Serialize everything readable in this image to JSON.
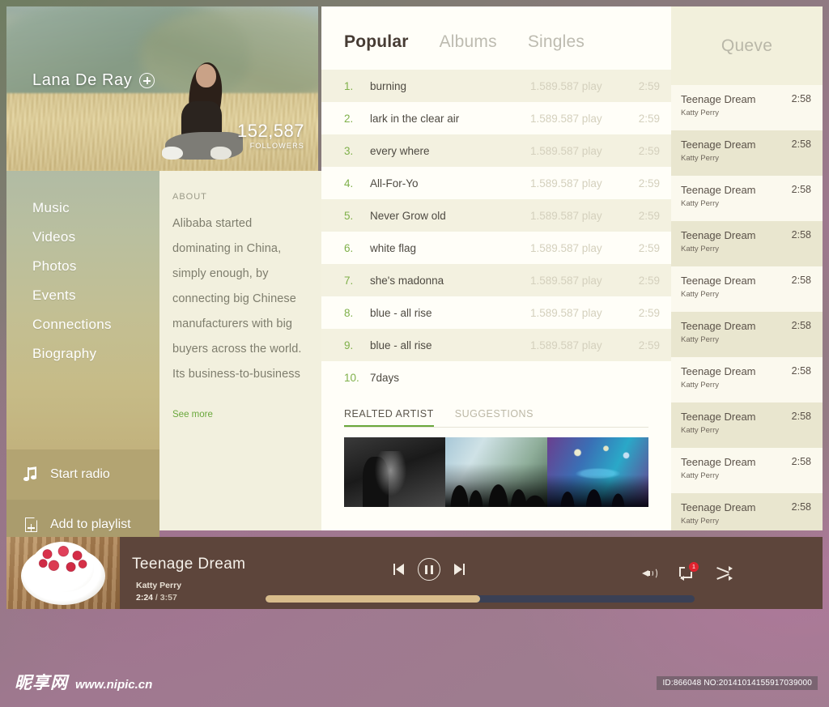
{
  "hero": {
    "artist_name": "Lana De Ray",
    "follow_icon": "plus-circle-icon",
    "followers_count": "152,587",
    "followers_label": "FOLLOWERS"
  },
  "sidebar": {
    "items": [
      {
        "label": "Music"
      },
      {
        "label": "Videos"
      },
      {
        "label": "Photos"
      },
      {
        "label": "Events"
      },
      {
        "label": "Connections"
      },
      {
        "label": "Biography"
      }
    ],
    "actions": [
      {
        "label": "Start radio",
        "icon": "music-note-icon"
      },
      {
        "label": "Add to playlist",
        "icon": "page-plus-icon"
      }
    ]
  },
  "about": {
    "title": "ABOUT",
    "text": "Alibaba started dominating in China, simply enough, by connecting big Chinese manufacturers with big buyers across the world. Its business-to-business",
    "see_more": "See more",
    "see_more_color": "#6aa83c"
  },
  "main": {
    "tabs": [
      {
        "label": "Popular",
        "active": true
      },
      {
        "label": "Albums",
        "active": false
      },
      {
        "label": "Singles",
        "active": false
      }
    ],
    "tracks": [
      {
        "num": "1.",
        "title": "burning",
        "plays": "1.589.587 play",
        "dur": "2:59"
      },
      {
        "num": "2.",
        "title": "lark in the clear air",
        "plays": "1.589.587 play",
        "dur": "2:59"
      },
      {
        "num": "3.",
        "title": "every where",
        "plays": "1.589.587 play",
        "dur": "2:59"
      },
      {
        "num": "4.",
        "title": "All-For-Yo",
        "plays": "1.589.587 play",
        "dur": "2:59"
      },
      {
        "num": "5.",
        "title": "Never Grow old",
        "plays": "1.589.587 play",
        "dur": "2:59"
      },
      {
        "num": "6.",
        "title": "white flag",
        "plays": "1.589.587 play",
        "dur": "2:59"
      },
      {
        "num": "7.",
        "title": "she's madonna",
        "plays": "1.589.587 play",
        "dur": "2:59"
      },
      {
        "num": "8.",
        "title": "blue - all rise",
        "plays": "1.589.587 play",
        "dur": "2:59"
      },
      {
        "num": "9.",
        "title": "blue - all rise",
        "plays": "1.589.587 play",
        "dur": "2:59"
      },
      {
        "num": "10.",
        "title": "7days",
        "plays": "",
        "dur": ""
      }
    ],
    "related_tabs": [
      {
        "label": "REALTED ARTIST",
        "active": true
      },
      {
        "label": "SUGGESTIONS",
        "active": false
      }
    ],
    "thumbnails": [
      {
        "name": "concert-bw-thumbnail"
      },
      {
        "name": "crowd-hands-thumbnail"
      },
      {
        "name": "stage-lights-thumbnail"
      }
    ]
  },
  "queue": {
    "title": "Queve",
    "items": [
      {
        "title": "Teenage Dream",
        "artist": "Katty Perry",
        "dur": "2:58"
      },
      {
        "title": "Teenage Dream",
        "artist": "Katty Perry",
        "dur": "2:58"
      },
      {
        "title": "Teenage Dream",
        "artist": "Katty Perry",
        "dur": "2:58"
      },
      {
        "title": "Teenage Dream",
        "artist": "Katty Perry",
        "dur": "2:58"
      },
      {
        "title": "Teenage Dream",
        "artist": "Katty Perry",
        "dur": "2:58"
      },
      {
        "title": "Teenage Dream",
        "artist": "Katty Perry",
        "dur": "2:58"
      },
      {
        "title": "Teenage Dream",
        "artist": "Katty Perry",
        "dur": "2:58"
      },
      {
        "title": "Teenage Dream",
        "artist": "Katty Perry",
        "dur": "2:58"
      },
      {
        "title": "Teenage Dream",
        "artist": "Katty Perry",
        "dur": "2:58"
      },
      {
        "title": "Teenage Dream",
        "artist": "Katty Perry",
        "dur": "2:58"
      }
    ]
  },
  "player": {
    "album_art": "raspberries-in-cup-artwork",
    "track_title": "Teenage  Dream",
    "artist": "Katty Perry",
    "current_time": "2:24",
    "total_time": "3:57",
    "time_separator": " / ",
    "progress_percent": 50,
    "controls": [
      {
        "name": "previous-button",
        "icon": "skip-previous-icon"
      },
      {
        "name": "pause-button",
        "icon": "pause-circle-icon"
      },
      {
        "name": "next-button",
        "icon": "skip-next-icon"
      }
    ],
    "right_controls": [
      {
        "name": "volume-button",
        "icon": "volume-icon"
      },
      {
        "name": "repeat-button",
        "icon": "repeat-icon",
        "badge": "1"
      },
      {
        "name": "shuffle-button",
        "icon": "shuffle-icon"
      }
    ],
    "progress_fill_color": "#d8bc8b",
    "progress_track_color": "#3a4055",
    "bar_color": "#5d453b"
  },
  "watermark": {
    "site_name_cn": "昵享网",
    "site_url": "www.nipic.cn",
    "id_text": "ID:866048 NO:20141014155917039000"
  }
}
